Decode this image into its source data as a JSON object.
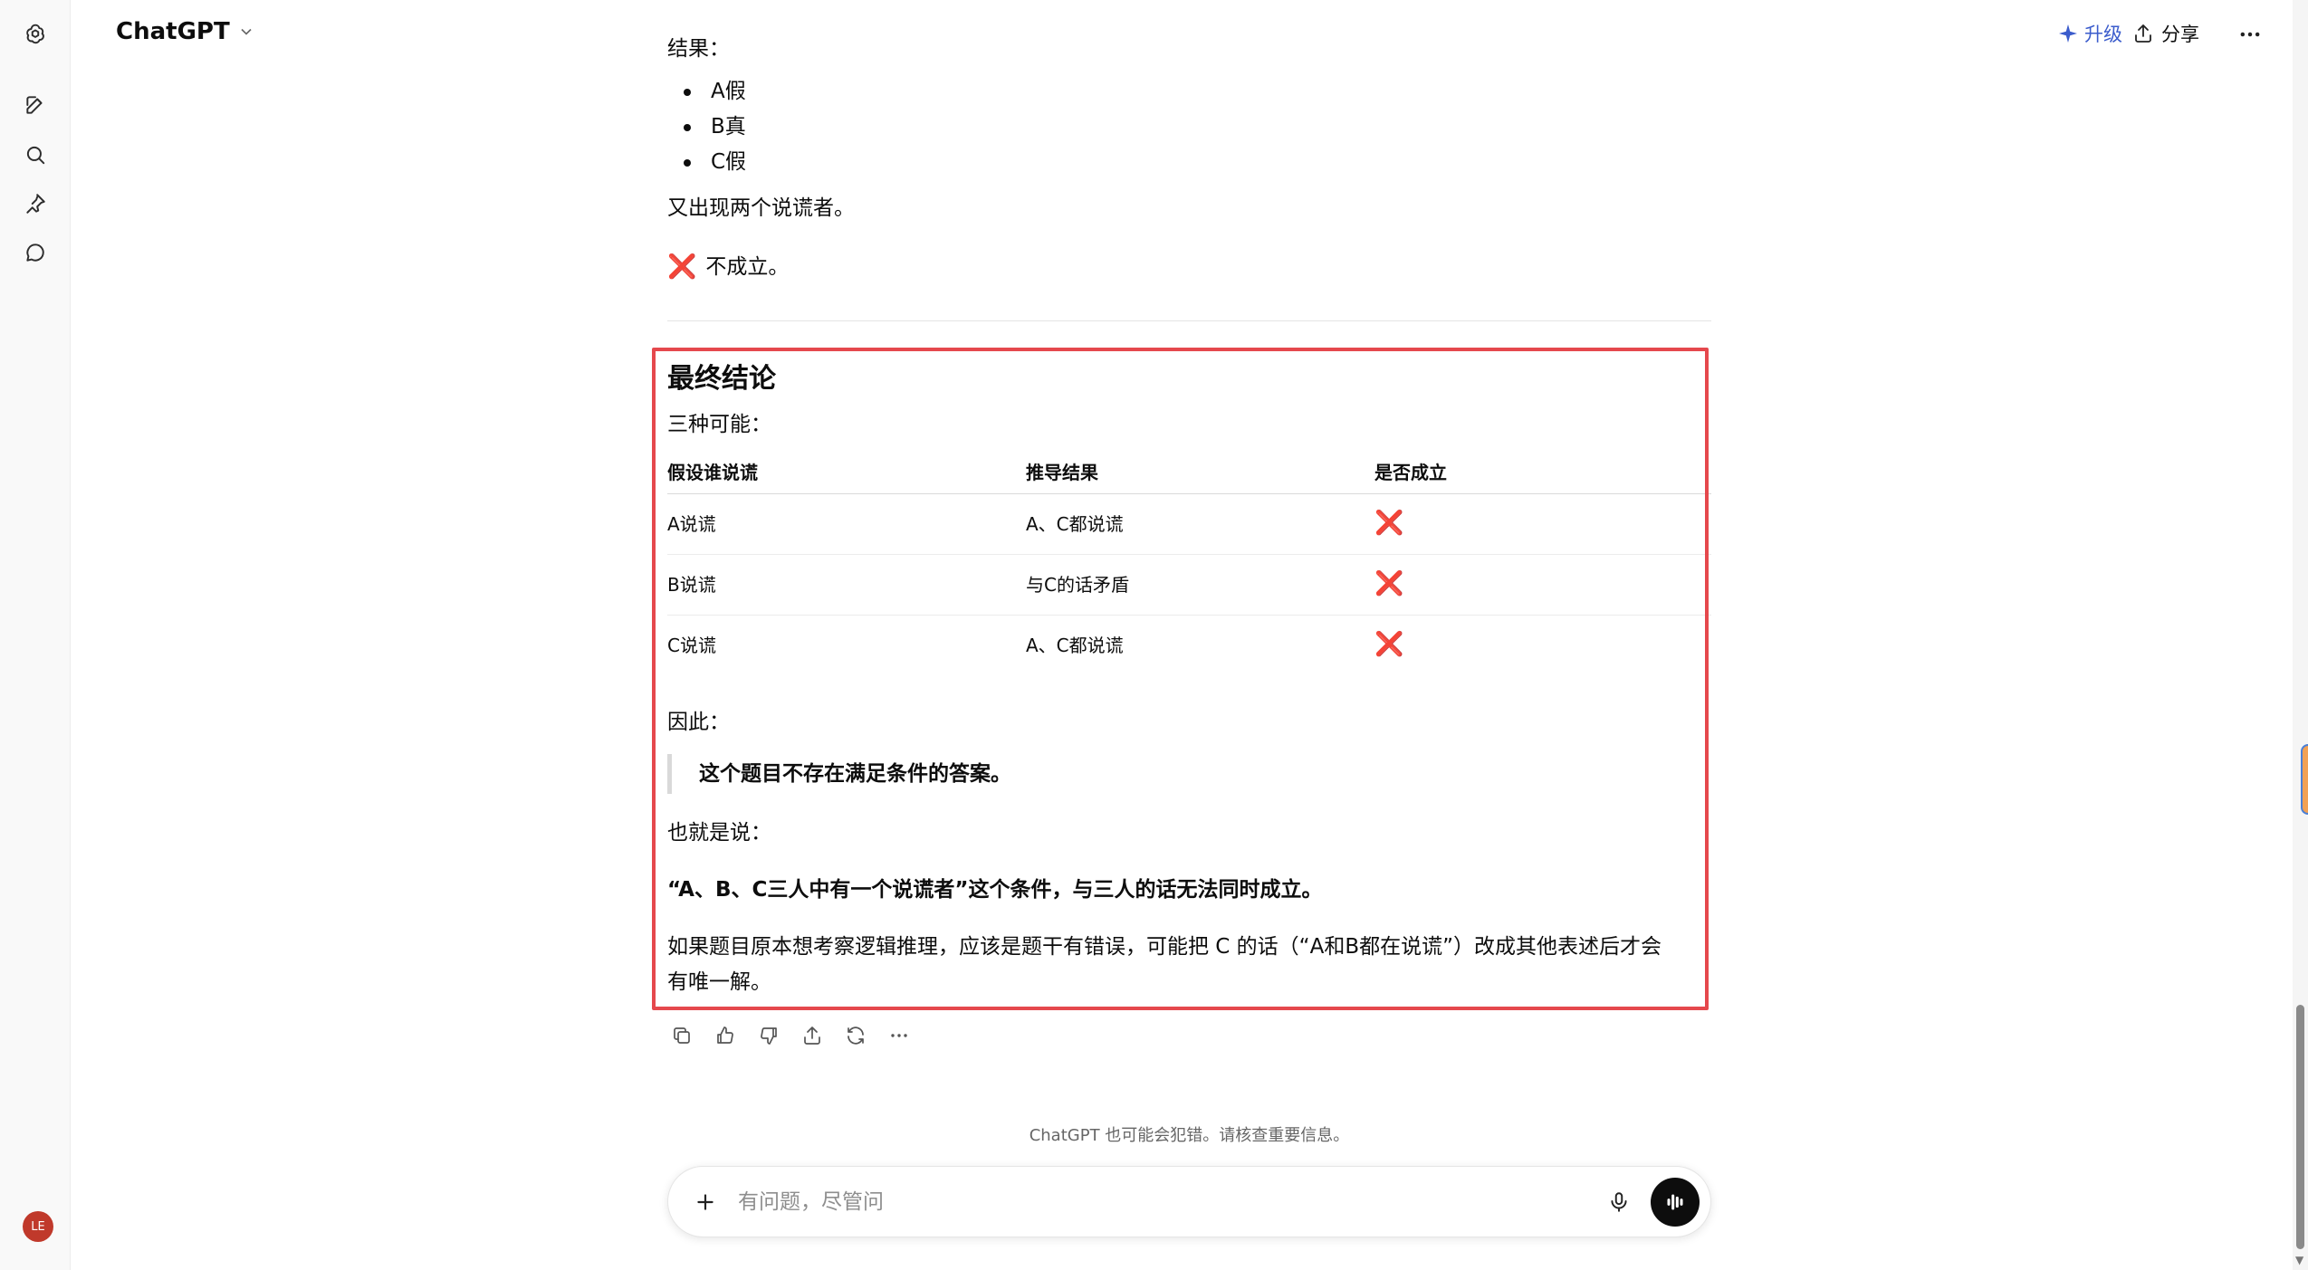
{
  "header": {
    "model_name": "ChatGPT",
    "upgrade_label": "升级",
    "share_label": "分享"
  },
  "sidebar": {
    "avatar_initials": "LE"
  },
  "earlier_answer": {
    "result_label": "结果：",
    "results": [
      "A假",
      "B真",
      "C假"
    ],
    "note": "又出现两个说谎者。",
    "verdict_icon": "❌",
    "verdict": "不成立。"
  },
  "conclusion": {
    "title": "最终结论",
    "intro": "三种可能：",
    "table": {
      "headers": [
        "假设谁说谎",
        "推导结果",
        "是否成立"
      ],
      "rows": [
        [
          "A说谎",
          "A、C都说谎",
          "❌"
        ],
        [
          "B说谎",
          "与C的话矛盾",
          "❌"
        ],
        [
          "C说谎",
          "A、C都说谎",
          "❌"
        ]
      ]
    },
    "therefore": "因此：",
    "quote": "这个题目不存在满足条件的答案。",
    "that_is": "也就是说：",
    "bold_statement": "“A、B、C三人中有一个说谎者”这个条件，与三人的话无法同时成立。",
    "final_line_1": "如果题目原本想考察逻辑推理，应该是题干有错误，可能把 C 的话（“A和B都在说谎”）改成其他表述后才会",
    "final_line_2": "有唯一解。"
  },
  "footer": {
    "disclaimer": "ChatGPT 也可能会犯错。请核查重要信息。",
    "composer_placeholder": "有问题，尽管问"
  },
  "colors": {
    "highlight_border": "#e5484d",
    "upgrade_accent": "#3b5ccc",
    "cross_mark": "#e0245e"
  }
}
